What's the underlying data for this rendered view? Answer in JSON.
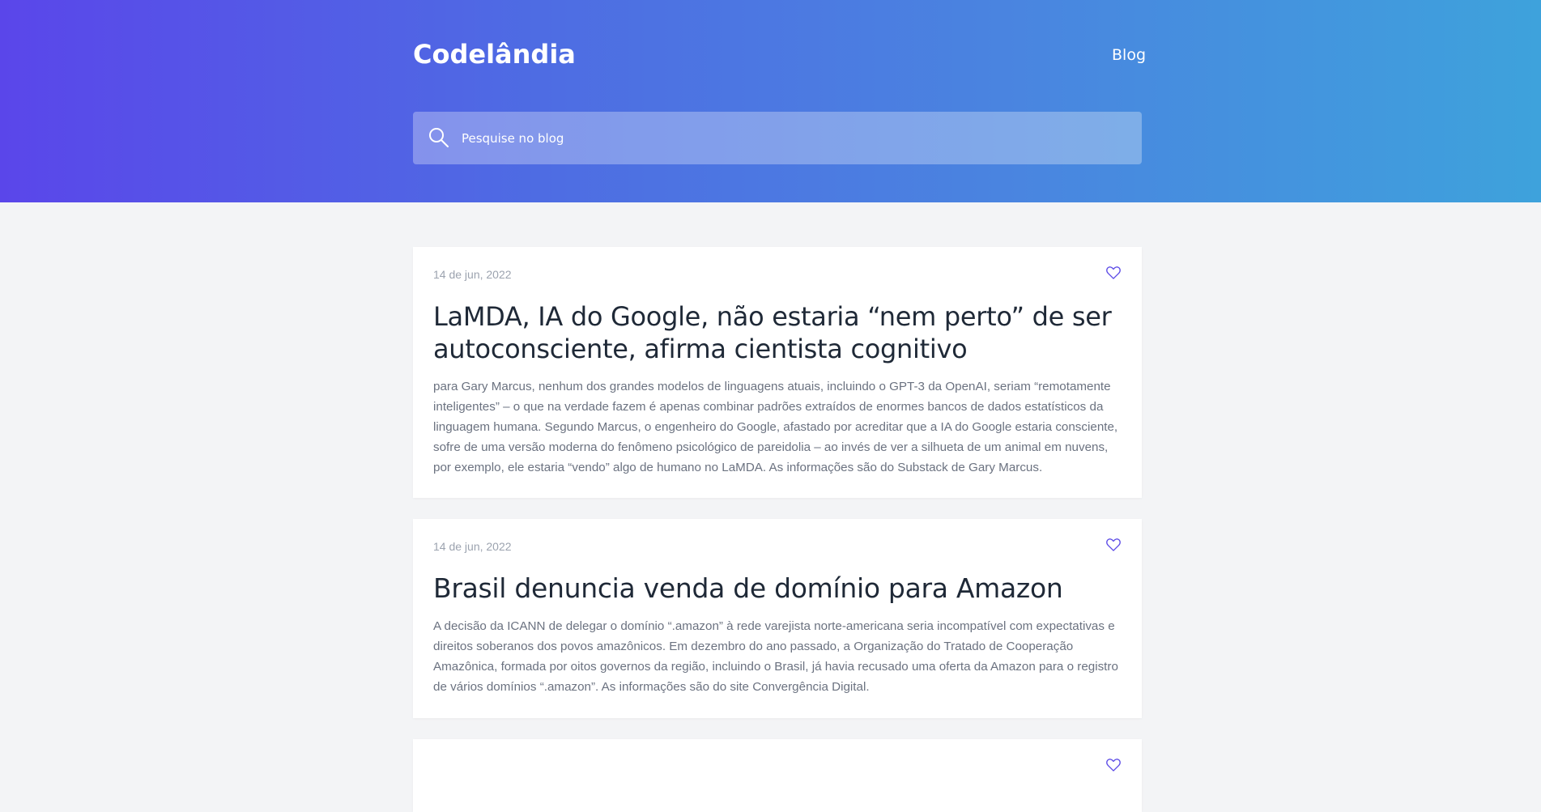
{
  "header": {
    "brand": "Codelândia",
    "nav_blog": "Blog",
    "search_placeholder": "Pesquise no blog",
    "search_value": ""
  },
  "posts": [
    {
      "date": "14 de jun, 2022",
      "title": "LaMDA, IA do Google, não estaria “nem perto” de ser autoconsciente, afirma cientista cognitivo",
      "excerpt": "para Gary Marcus, nenhum dos grandes modelos de linguagens atuais, incluindo o GPT-3 da OpenAI, seriam “remotamente inteligentes” – o que na verdade fazem é apenas combinar padrões extraídos de enormes bancos de dados estatísticos da linguagem humana. Segundo Marcus, o engenheiro do Google, afastado por acreditar que a IA do Google estaria consciente, sofre de uma versão moderna do fenômeno psicológico de pareidolia – ao invés de ver a silhueta de um animal em nuvens, por exemplo, ele estaria “vendo” algo de humano no LaMDA. As informações são do Substack de Gary Marcus.",
      "favorite_icon": "heart-outline-icon"
    },
    {
      "date": "14 de jun, 2022",
      "title": "Brasil denuncia venda de domínio para Amazon",
      "excerpt": "A decisão da ICANN de delegar o domínio “.amazon” à rede varejista norte-americana seria incompatível com expectativas e direitos soberanos dos povos amazônicos. Em dezembro do ano passado, a Organização do Tratado de Cooperação Amazônica, formada por oitos governos da região, incluindo o Brasil, já havia recusado uma oferta da Amazon para o registro de vários domínios “.amazon”. As informações são do site Convergência Digital.",
      "favorite_icon": "heart-outline-icon"
    },
    {
      "favorite_icon": "heart-outline-icon"
    }
  ],
  "colors": {
    "gradient_start": "#5a46ea",
    "gradient_end": "#3ea2dc",
    "heart": "#5b4ae6",
    "page_bg": "#f3f4f6",
    "title": "#1f2937",
    "muted": "#9ca3af"
  }
}
